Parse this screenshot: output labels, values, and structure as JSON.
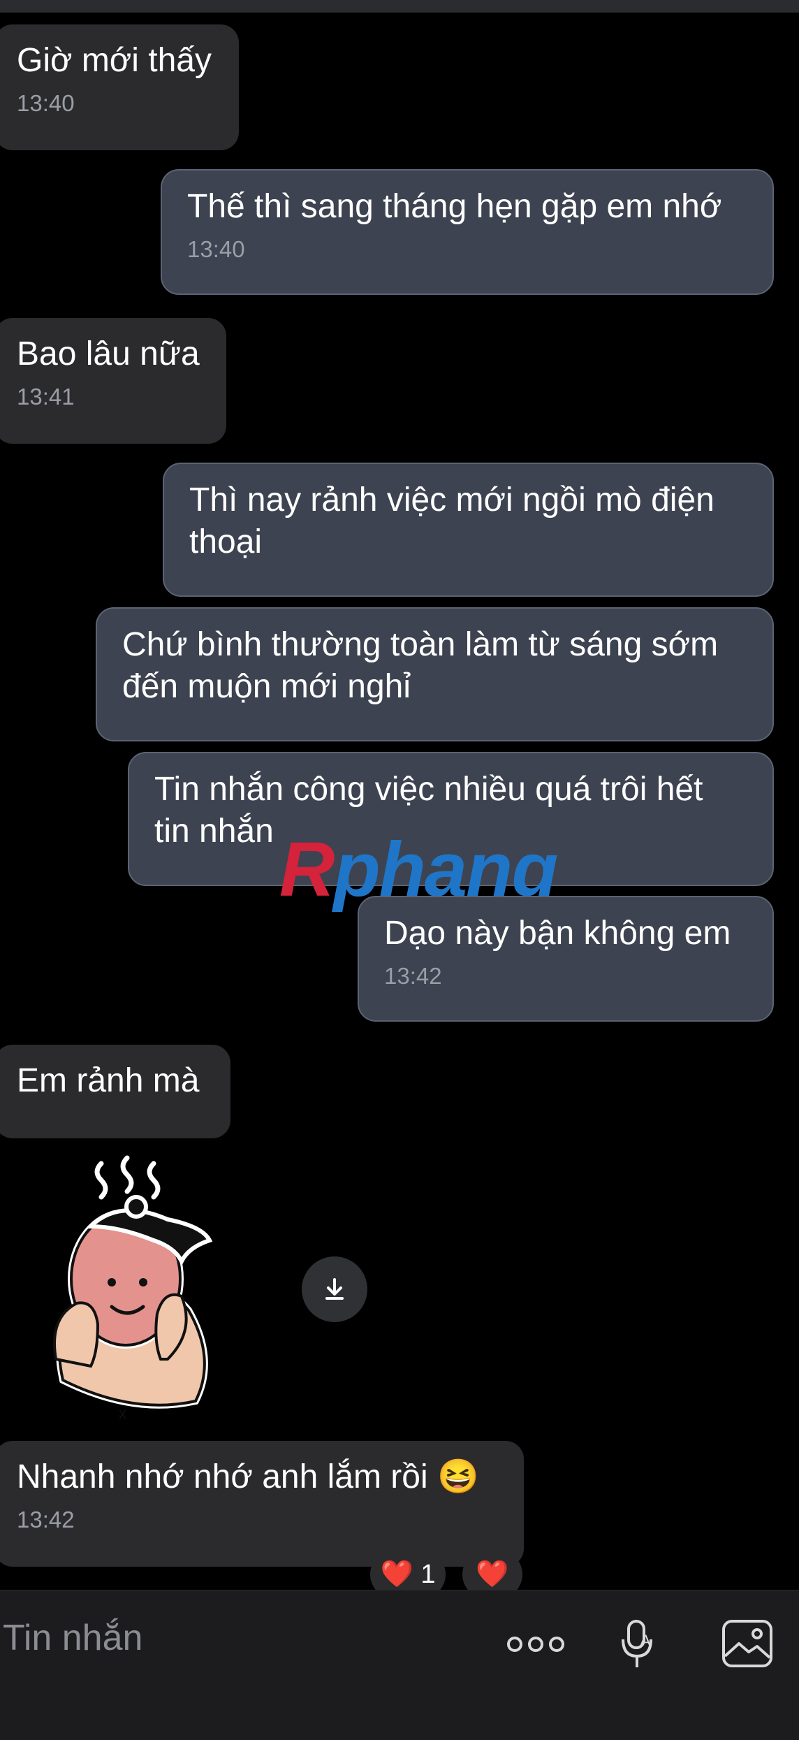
{
  "messages": [
    {
      "dir": "in",
      "text": "Giờ mới thấy",
      "time": "13:40"
    },
    {
      "dir": "out",
      "text": "Thế thì sang tháng hẹn gặp em nhớ",
      "time": "13:40"
    },
    {
      "dir": "in",
      "text": "Bao lâu nữa",
      "time": "13:41"
    },
    {
      "dir": "out",
      "text1": "Thì nay rảnh việc mới ngồi mò điện",
      "text2": "thoại"
    },
    {
      "dir": "out",
      "text1": "Chứ bình thường toàn làm từ sáng sớm",
      "text2": "đến muộn mới nghỉ"
    },
    {
      "dir": "out",
      "text1": "Tin nhắn công việc nhiều quá trôi hết",
      "text2": "tin nhắn"
    },
    {
      "dir": "out",
      "text": "Dạo này bận không em",
      "time": "13:42"
    },
    {
      "dir": "in",
      "text": "Em rảnh mà"
    },
    {
      "dir": "in",
      "text": "Nhanh nhớ nhớ anh lắm rồi 😆",
      "time": "13:42"
    }
  ],
  "watermark": {
    "first": "R",
    "rest": "phang"
  },
  "sticker": {
    "icon": "sticker-character",
    "download_icon": "download-icon"
  },
  "reactions": {
    "heart_count_label": "❤️ 1",
    "heart_only": "❤️"
  },
  "composer": {
    "placeholder": "Tin nhắn",
    "icons": [
      "more-icon",
      "voice-icon",
      "image-icon"
    ]
  },
  "colors": {
    "incoming": "#2b2b2d",
    "outgoing": "#3d4350",
    "background": "#000000"
  }
}
